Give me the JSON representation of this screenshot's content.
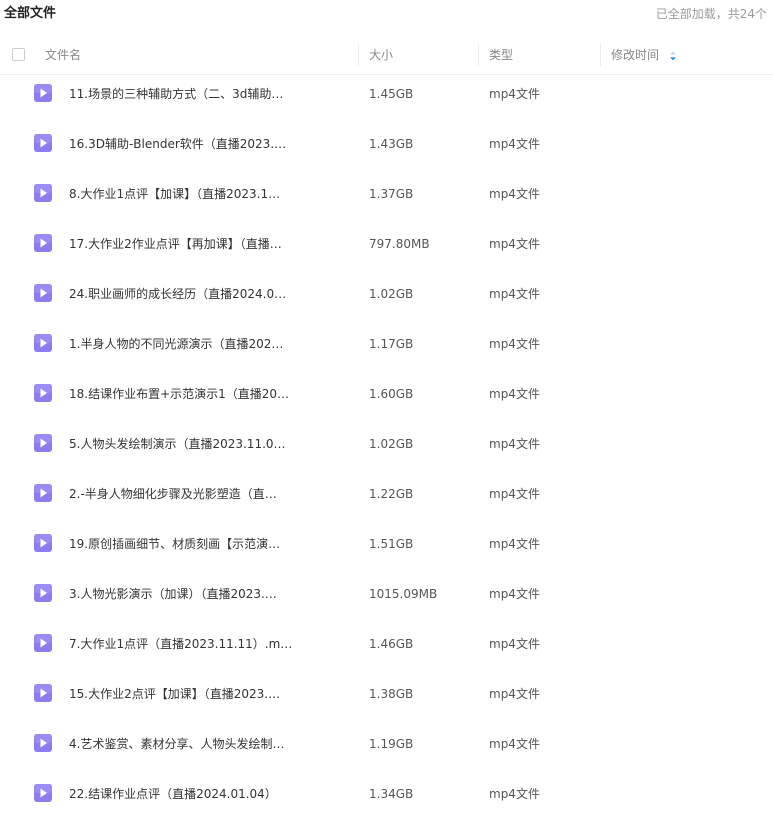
{
  "header": {
    "title": "全部文件",
    "load_status": "已全部加载，共24个"
  },
  "table": {
    "columns": {
      "name": "文件名",
      "size": "大小",
      "type": "类型",
      "modified": "修改时间"
    },
    "rows": [
      {
        "name": "11.场景的三种辅助方式（二、3d辅助…",
        "size": "1.45GB",
        "type": "mp4文件"
      },
      {
        "name": "16.3D辅助-Blender软件（直播2023.…",
        "size": "1.43GB",
        "type": "mp4文件"
      },
      {
        "name": "8.大作业1点评【加课】（直播2023.1…",
        "size": "1.37GB",
        "type": "mp4文件"
      },
      {
        "name": "17.大作业2作业点评【再加课】（直播…",
        "size": "797.80MB",
        "type": "mp4文件"
      },
      {
        "name": "24.职业画师的成长经历（直播2024.0…",
        "size": "1.02GB",
        "type": "mp4文件"
      },
      {
        "name": "1.半身人物的不同光源演示（直播202…",
        "size": "1.17GB",
        "type": "mp4文件"
      },
      {
        "name": "18.结课作业布置+示范演示1（直播20…",
        "size": "1.60GB",
        "type": "mp4文件"
      },
      {
        "name": "5.人物头发绘制演示（直播2023.11.0…",
        "size": "1.02GB",
        "type": "mp4文件"
      },
      {
        "name": "2.-半身人物细化步骤及光影塑造（直…",
        "size": "1.22GB",
        "type": "mp4文件"
      },
      {
        "name": "19.原创插画细节、材质刻画【示范演…",
        "size": "1.51GB",
        "type": "mp4文件"
      },
      {
        "name": "3.人物光影演示（加课）（直播2023.…",
        "size": "1015.09MB",
        "type": "mp4文件"
      },
      {
        "name": "7.大作业1点评（直播2023.11.11）.m…",
        "size": "1.46GB",
        "type": "mp4文件"
      },
      {
        "name": "15.大作业2点评【加课】（直播2023.…",
        "size": "1.38GB",
        "type": "mp4文件"
      },
      {
        "name": "4.艺术鉴赏、素材分享、人物头发绘制…",
        "size": "1.19GB",
        "type": "mp4文件"
      },
      {
        "name": "22.结课作业点评（直播2024.01.04）",
        "size": "1.34GB",
        "type": "mp4文件"
      }
    ]
  },
  "colors": {
    "video_icon": "#8c7cf0",
    "sort_icon": "#3d8fe6"
  },
  "icons": {
    "row_icon": "video-file-icon",
    "sort": "sort-desc-icon",
    "select_all": "checkbox-icon"
  }
}
